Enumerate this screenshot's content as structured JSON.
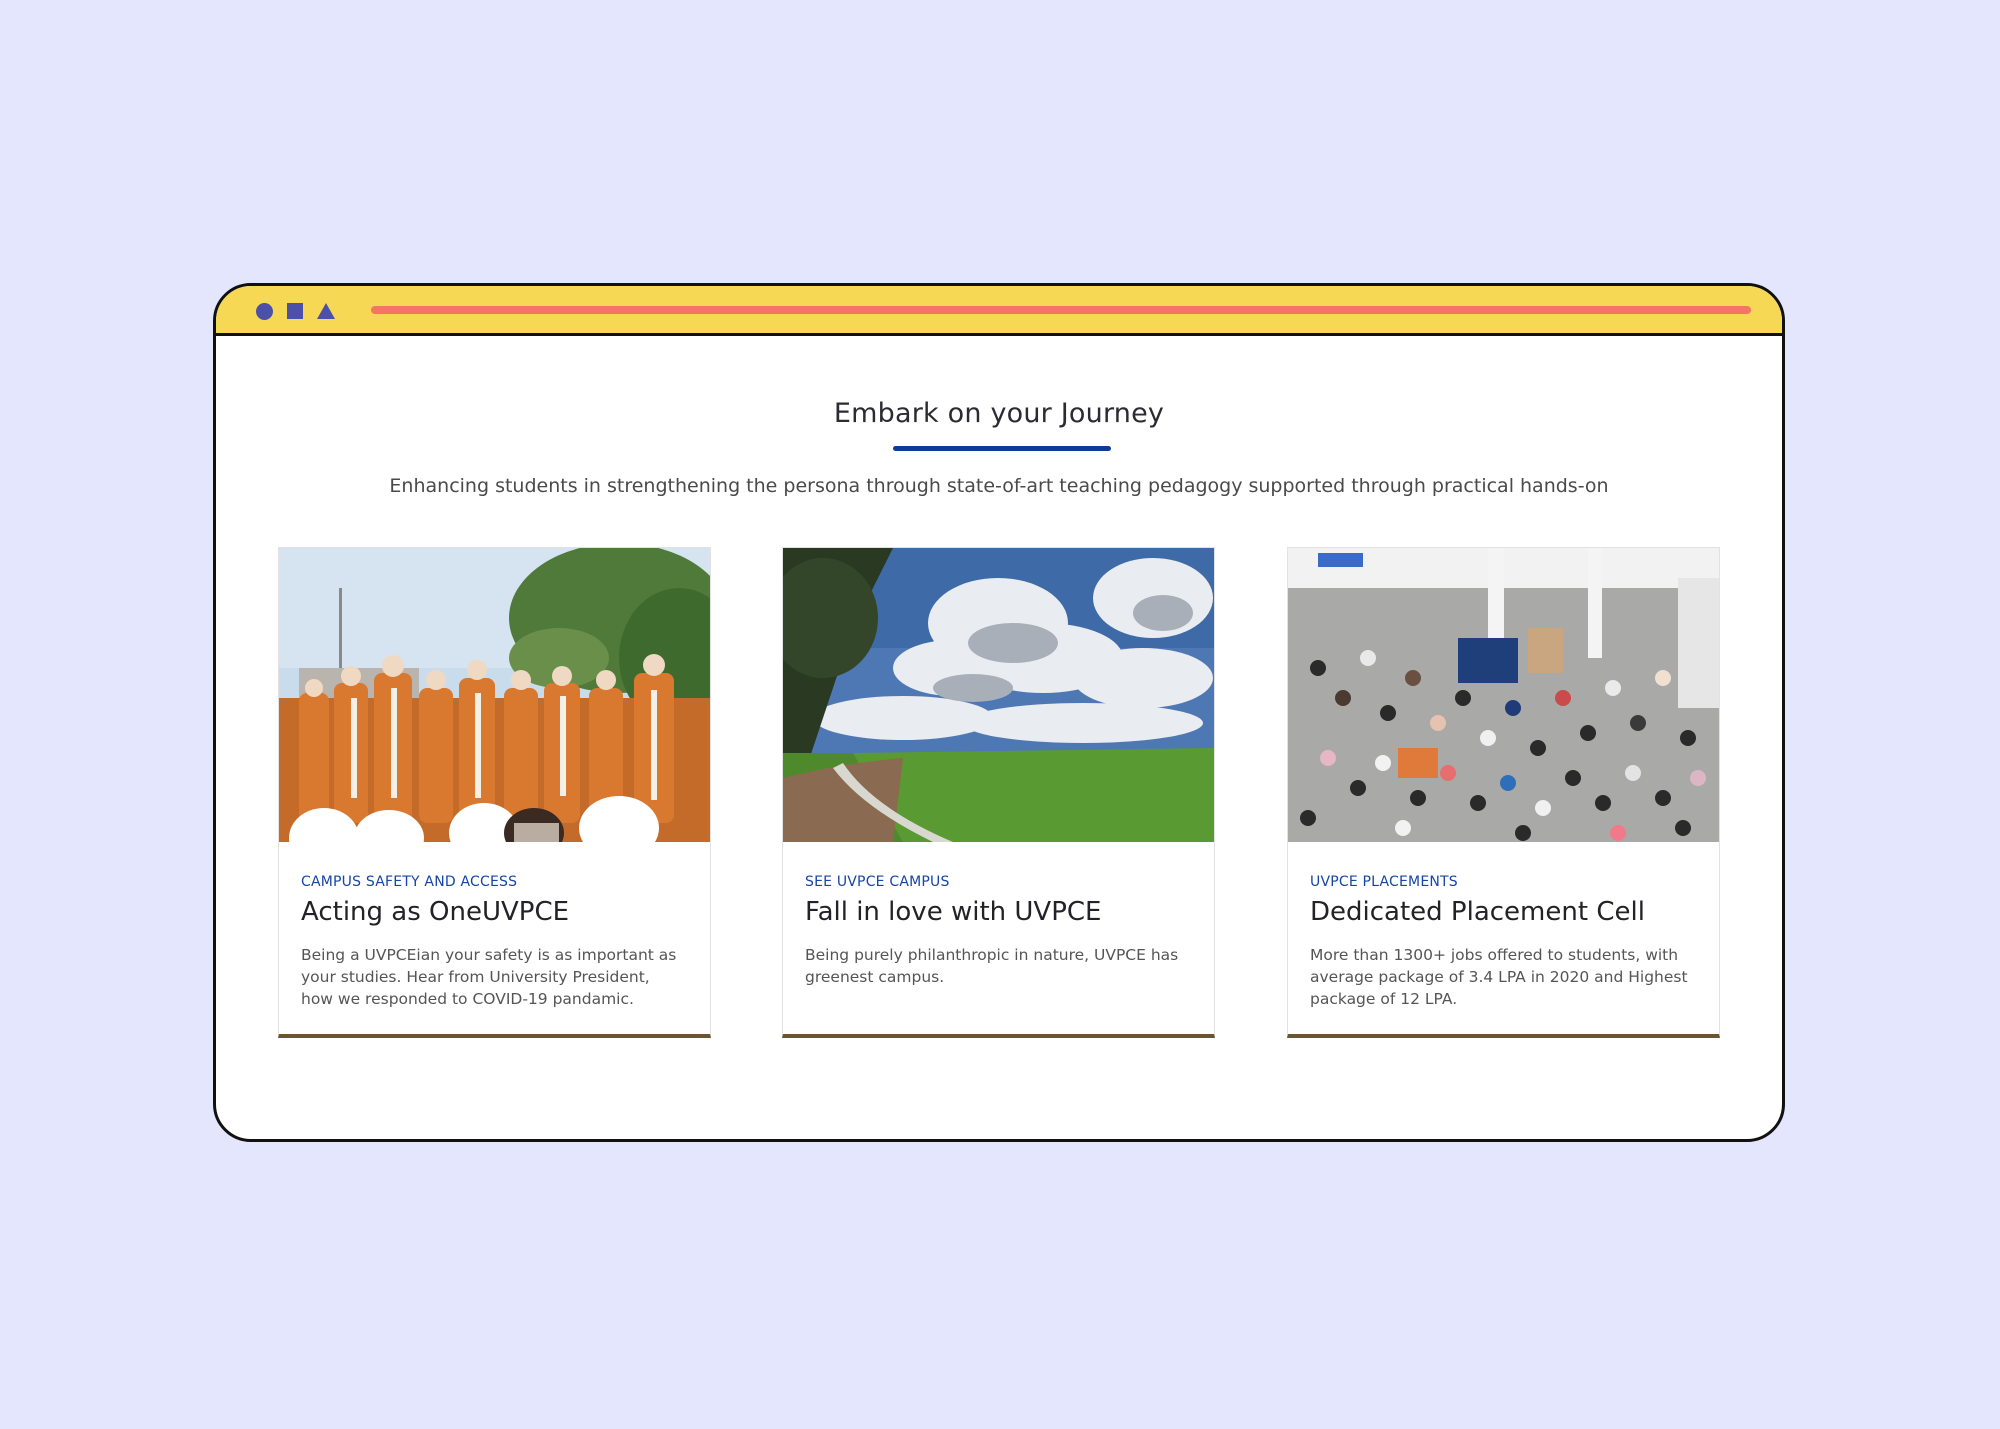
{
  "colors": {
    "page_background": "#e3e6fd",
    "titlebar": "#f7d855",
    "address_bar": "#f47566",
    "window_icons": "#4b50a8",
    "accent_underline": "#0f3a9c",
    "category_text": "#1745a6",
    "card_bottom_border": "#6c5430"
  },
  "window": {
    "icons": [
      "circle-icon",
      "square-icon",
      "triangle-icon"
    ]
  },
  "section": {
    "title": "Embark on your Journey",
    "subtitle": "Enhancing students in strengthening the persona through state-of-art teaching pedagogy supported through practical hands-on"
  },
  "cards": [
    {
      "category": "CAMPUS SAFETY AND ACCESS",
      "title": "Acting as OneUVPCE",
      "description": "Being a UVPCEian your safety is as important as your studies. Hear from University President, how we responded to COVID-19 pandamic.",
      "image": "graduates-in-robes-photo"
    },
    {
      "category": "SEE UVPCE CAMPUS",
      "title": "Fall in love with UVPCE",
      "description": "Being purely philanthropic in nature, UVPCE has greenest campus.",
      "image": "green-campus-field-photo"
    },
    {
      "category": "UVPCE PLACEMENTS",
      "title": "Dedicated Placement Cell",
      "description": "More than 1300+ jobs offered to students, with average package of 3.4 LPA in 2020 and Highest package of 12 LPA.",
      "image": "placement-crowd-photo"
    }
  ]
}
